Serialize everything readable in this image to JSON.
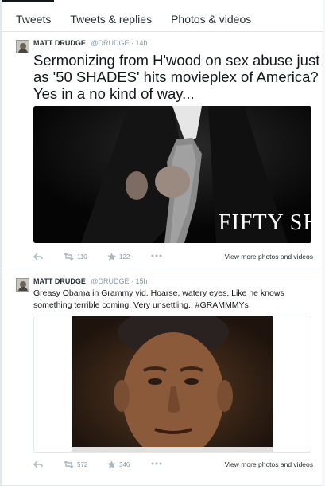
{
  "tabs": [
    {
      "label": "Tweets",
      "active": true
    },
    {
      "label": "Tweets & replies",
      "active": false
    },
    {
      "label": "Photos & videos",
      "active": false
    }
  ],
  "tweets": [
    {
      "name": "MATT DRUDGE",
      "handle": "@DRUDGE",
      "time": "· 14h",
      "text": "Sermonizing from H'wood on sex abuse just as '50 SHADES' hits movieplex of America? Yes in a no kind of way...",
      "media_caption": "FIFTY SHADES",
      "retweets": "110",
      "favorites": "122",
      "more_label": "View more photos and videos"
    },
    {
      "name": "MATT DRUDGE",
      "handle": "@DRUDGE",
      "time": "· 15h",
      "text": "Greasy Obama in Grammy vid. Hoarse, watery eyes. Like he knows something terrible coming. Very unsettling.. #GRAMMMYs",
      "retweets": "572",
      "favorites": "346",
      "more_label": "View more photos and videos"
    }
  ],
  "colors": {
    "icon_gray": "#aab8c2",
    "text_dark": "#14171a",
    "meta_gray": "#8899a6"
  }
}
